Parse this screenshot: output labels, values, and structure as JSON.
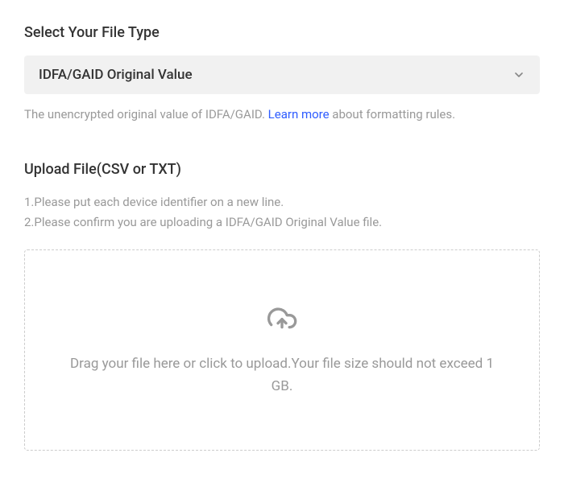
{
  "fileType": {
    "heading": "Select Your File Type",
    "selected": "IDFA/GAID Original Value",
    "helpPrefix": "The unencrypted original value of IDFA/GAID. ",
    "learnMore": "Learn more",
    "helpSuffix": " about formatting rules."
  },
  "upload": {
    "heading": "Upload File(CSV or TXT)",
    "instruction1": "1.Please put each device identifier on a new line.",
    "instruction2": "2.Please confirm you are uploading a IDFA/GAID Original Value file.",
    "dropzoneText": "Drag your file here or click to upload.Your file size should not exceed 1 GB."
  }
}
